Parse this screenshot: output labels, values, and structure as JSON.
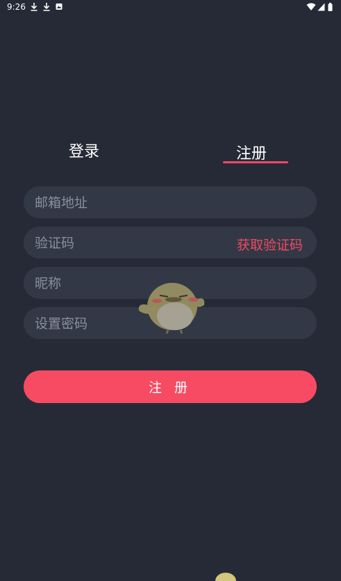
{
  "status_bar": {
    "time": "9:26",
    "left_icons": [
      "download-icon",
      "download-icon",
      "photo-icon"
    ],
    "right_icons": [
      "wifi-icon",
      "signal-icon",
      "battery-icon"
    ]
  },
  "tabs": {
    "login_label": "登录",
    "register_label": "注册",
    "active": "register"
  },
  "form": {
    "email_placeholder": "邮箱地址",
    "code_placeholder": "验证码",
    "get_code_label": "获取验证码",
    "nickname_placeholder": "昵称",
    "password_placeholder": "设置密码",
    "submit_label": "注 册"
  },
  "colors": {
    "background": "#262a36",
    "field": "#333846",
    "accent": "#f64b63",
    "placeholder": "#8a8f9f"
  }
}
